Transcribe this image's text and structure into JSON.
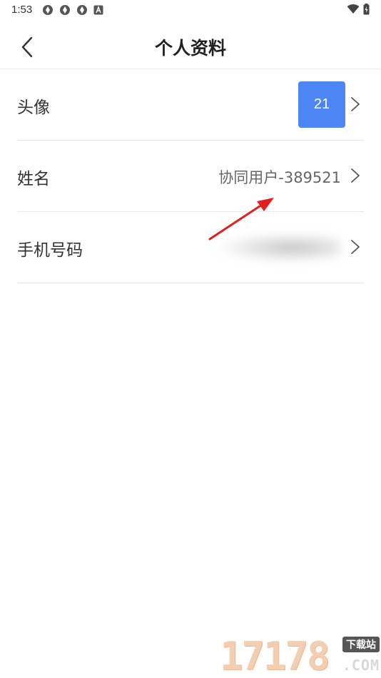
{
  "status_bar": {
    "time": "1:53",
    "notification_icons": [
      "sync-icon",
      "sync-icon",
      "sync-icon",
      "keyboard-a-icon"
    ],
    "right_icons": [
      "wifi-icon",
      "battery-icon"
    ]
  },
  "header": {
    "title": "个人资料",
    "back_icon": "chevron-left-icon"
  },
  "profile": {
    "avatar": {
      "label": "头像",
      "avatar_text": "21",
      "avatar_color": "#4c86f4"
    },
    "name": {
      "label": "姓名",
      "value": "协同用户-389521"
    },
    "phone": {
      "label": "手机号码",
      "value_blurred": true
    }
  },
  "annotation": {
    "arrow_color": "#e02020"
  },
  "watermark": {
    "digits": "17178",
    "tag": "下载站",
    "suffix": ".COM"
  }
}
